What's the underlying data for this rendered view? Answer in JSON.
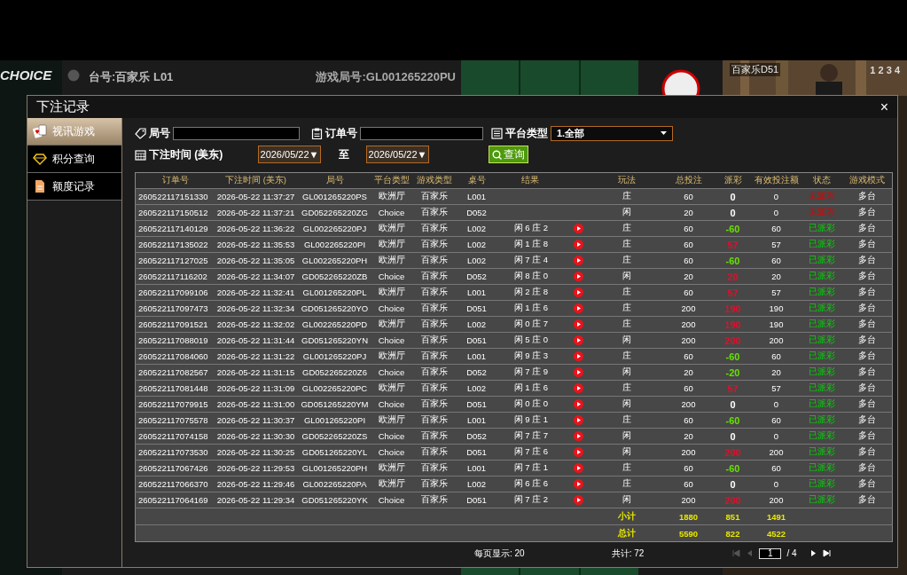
{
  "background": {
    "logo": "CHOICE",
    "table_label": "台号:百家乐 L01",
    "round_label": "游戏局号:GL001265220PU",
    "video_label": "百家乐D51",
    "seats": "1 2 3 4"
  },
  "window": {
    "title": "下注记录",
    "close": "×"
  },
  "sidebar": {
    "items": [
      {
        "label": "视讯游戏",
        "kind": "cards",
        "selected": true
      },
      {
        "label": "积分查询",
        "kind": "diamond",
        "selected": false
      },
      {
        "label": "额度记录",
        "kind": "document",
        "selected": false
      }
    ]
  },
  "filters": {
    "round": {
      "label": "局号"
    },
    "order": {
      "label": "订单号"
    },
    "platform": {
      "label": "平台类型",
      "value": "1.全部"
    },
    "time": {
      "label": "下注时间 (美东)",
      "from": "2026/05/22▼",
      "to_label": "至",
      "to": "2026/05/22▼"
    },
    "search_button": "查询"
  },
  "table": {
    "columns": [
      "订单号",
      "下注时间 (美东)",
      "局号",
      "平台类型",
      "游戏类型",
      "桌号",
      "结果",
      "",
      "玩法",
      "总投注",
      "派彩",
      "有效投注额",
      "状态",
      "游戏模式"
    ],
    "rows": [
      {
        "order": "260522117151330",
        "time": "2026-05-22 11:37:27",
        "round": "GL001265220PS",
        "platform": "欧洲厅",
        "game": "百家乐",
        "table": "L001",
        "result": "",
        "replay": false,
        "bet_type": "庄",
        "total": "60",
        "payout": {
          "text": "0",
          "color": "#ffffff"
        },
        "valid": "0",
        "status": {
          "text": "未派彩",
          "settled": false
        },
        "mode": "多台"
      },
      {
        "order": "260522117150512",
        "time": "2026-05-22 11:37:21",
        "round": "GD052265220ZG",
        "platform": "Choice",
        "game": "百家乐",
        "table": "D052",
        "result": "",
        "replay": false,
        "bet_type": "闲",
        "total": "20",
        "payout": {
          "text": "0",
          "color": "#ffffff"
        },
        "valid": "0",
        "status": {
          "text": "未派彩",
          "settled": false
        },
        "mode": "多台"
      },
      {
        "order": "260522117140129",
        "time": "2026-05-22 11:36:22",
        "round": "GL002265220PJ",
        "platform": "欧洲厅",
        "game": "百家乐",
        "table": "L002",
        "result": "闲 6 庄 2",
        "replay": true,
        "bet_type": "庄",
        "total": "60",
        "payout": {
          "text": "-60",
          "color": "#66e000"
        },
        "valid": "60",
        "status": {
          "text": "已派彩",
          "settled": true
        },
        "mode": "多台"
      },
      {
        "order": "260522117135022",
        "time": "2026-05-22 11:35:53",
        "round": "GL002265220PI",
        "platform": "欧洲厅",
        "game": "百家乐",
        "table": "L002",
        "result": "闲 1 庄 8",
        "replay": true,
        "bet_type": "庄",
        "total": "60",
        "payout": {
          "text": "57",
          "color": "#e0102a"
        },
        "valid": "57",
        "status": {
          "text": "已派彩",
          "settled": true
        },
        "mode": "多台"
      },
      {
        "order": "260522117127025",
        "time": "2026-05-22 11:35:05",
        "round": "GL002265220PH",
        "platform": "欧洲厅",
        "game": "百家乐",
        "table": "L002",
        "result": "闲 7 庄 4",
        "replay": true,
        "bet_type": "庄",
        "total": "60",
        "payout": {
          "text": "-60",
          "color": "#66e000"
        },
        "valid": "60",
        "status": {
          "text": "已派彩",
          "settled": true
        },
        "mode": "多台"
      },
      {
        "order": "260522117116202",
        "time": "2026-05-22 11:34:07",
        "round": "GD052265220ZB",
        "platform": "Choice",
        "game": "百家乐",
        "table": "D052",
        "result": "闲 8 庄 0",
        "replay": true,
        "bet_type": "闲",
        "total": "20",
        "payout": {
          "text": "20",
          "color": "#e0102a"
        },
        "valid": "20",
        "status": {
          "text": "已派彩",
          "settled": true
        },
        "mode": "多台"
      },
      {
        "order": "260522117099106",
        "time": "2026-05-22 11:32:41",
        "round": "GL001265220PL",
        "platform": "欧洲厅",
        "game": "百家乐",
        "table": "L001",
        "result": "闲 2 庄 8",
        "replay": true,
        "bet_type": "庄",
        "total": "60",
        "payout": {
          "text": "57",
          "color": "#e0102a"
        },
        "valid": "57",
        "status": {
          "text": "已派彩",
          "settled": true
        },
        "mode": "多台"
      },
      {
        "order": "260522117097473",
        "time": "2026-05-22 11:32:34",
        "round": "GD051265220YO",
        "platform": "Choice",
        "game": "百家乐",
        "table": "D051",
        "result": "闲 1 庄 6",
        "replay": true,
        "bet_type": "庄",
        "total": "200",
        "payout": {
          "text": "190",
          "color": "#e0102a"
        },
        "valid": "190",
        "status": {
          "text": "已派彩",
          "settled": true
        },
        "mode": "多台"
      },
      {
        "order": "260522117091521",
        "time": "2026-05-22 11:32:02",
        "round": "GL002265220PD",
        "platform": "欧洲厅",
        "game": "百家乐",
        "table": "L002",
        "result": "闲 0 庄 7",
        "replay": true,
        "bet_type": "庄",
        "total": "200",
        "payout": {
          "text": "190",
          "color": "#e0102a"
        },
        "valid": "190",
        "status": {
          "text": "已派彩",
          "settled": true
        },
        "mode": "多台"
      },
      {
        "order": "260522117088019",
        "time": "2026-05-22 11:31:44",
        "round": "GD051265220YN",
        "platform": "Choice",
        "game": "百家乐",
        "table": "D051",
        "result": "闲 5 庄 0",
        "replay": true,
        "bet_type": "闲",
        "total": "200",
        "payout": {
          "text": "200",
          "color": "#e0102a"
        },
        "valid": "200",
        "status": {
          "text": "已派彩",
          "settled": true
        },
        "mode": "多台"
      },
      {
        "order": "260522117084060",
        "time": "2026-05-22 11:31:22",
        "round": "GL001265220PJ",
        "platform": "欧洲厅",
        "game": "百家乐",
        "table": "L001",
        "result": "闲 9 庄 3",
        "replay": true,
        "bet_type": "庄",
        "total": "60",
        "payout": {
          "text": "-60",
          "color": "#66e000"
        },
        "valid": "60",
        "status": {
          "text": "已派彩",
          "settled": true
        },
        "mode": "多台"
      },
      {
        "order": "260522117082567",
        "time": "2026-05-22 11:31:15",
        "round": "GD052265220Z6",
        "platform": "Choice",
        "game": "百家乐",
        "table": "D052",
        "result": "闲 7 庄 9",
        "replay": true,
        "bet_type": "闲",
        "total": "20",
        "payout": {
          "text": "-20",
          "color": "#66e000"
        },
        "valid": "20",
        "status": {
          "text": "已派彩",
          "settled": true
        },
        "mode": "多台"
      },
      {
        "order": "260522117081448",
        "time": "2026-05-22 11:31:09",
        "round": "GL002265220PC",
        "platform": "欧洲厅",
        "game": "百家乐",
        "table": "L002",
        "result": "闲 1 庄 6",
        "replay": true,
        "bet_type": "庄",
        "total": "60",
        "payout": {
          "text": "57",
          "color": "#e0102a"
        },
        "valid": "57",
        "status": {
          "text": "已派彩",
          "settled": true
        },
        "mode": "多台"
      },
      {
        "order": "260522117079915",
        "time": "2026-05-22 11:31:00",
        "round": "GD051265220YM",
        "platform": "Choice",
        "game": "百家乐",
        "table": "D051",
        "result": "闲 0 庄 0",
        "replay": true,
        "bet_type": "闲",
        "total": "200",
        "payout": {
          "text": "0",
          "color": "#ffffff"
        },
        "valid": "0",
        "status": {
          "text": "已派彩",
          "settled": true
        },
        "mode": "多台"
      },
      {
        "order": "260522117075578",
        "time": "2026-05-22 11:30:37",
        "round": "GL001265220PI",
        "platform": "欧洲厅",
        "game": "百家乐",
        "table": "L001",
        "result": "闲 9 庄 1",
        "replay": true,
        "bet_type": "庄",
        "total": "60",
        "payout": {
          "text": "-60",
          "color": "#66e000"
        },
        "valid": "60",
        "status": {
          "text": "已派彩",
          "settled": true
        },
        "mode": "多台"
      },
      {
        "order": "260522117074158",
        "time": "2026-05-22 11:30:30",
        "round": "GD052265220ZS",
        "platform": "Choice",
        "game": "百家乐",
        "table": "D052",
        "result": "闲 7 庄 7",
        "replay": true,
        "bet_type": "闲",
        "total": "20",
        "payout": {
          "text": "0",
          "color": "#ffffff"
        },
        "valid": "0",
        "status": {
          "text": "已派彩",
          "settled": true
        },
        "mode": "多台"
      },
      {
        "order": "260522117073530",
        "time": "2026-05-22 11:30:25",
        "round": "GD051265220YL",
        "platform": "Choice",
        "game": "百家乐",
        "table": "D051",
        "result": "闲 7 庄 6",
        "replay": true,
        "bet_type": "闲",
        "total": "200",
        "payout": {
          "text": "200",
          "color": "#e0102a"
        },
        "valid": "200",
        "status": {
          "text": "已派彩",
          "settled": true
        },
        "mode": "多台"
      },
      {
        "order": "260522117067426",
        "time": "2026-05-22 11:29:53",
        "round": "GL001265220PH",
        "platform": "欧洲厅",
        "game": "百家乐",
        "table": "L001",
        "result": "闲 7 庄 1",
        "replay": true,
        "bet_type": "庄",
        "total": "60",
        "payout": {
          "text": "-60",
          "color": "#66e000"
        },
        "valid": "60",
        "status": {
          "text": "已派彩",
          "settled": true
        },
        "mode": "多台"
      },
      {
        "order": "260522117066370",
        "time": "2026-05-22 11:29:46",
        "round": "GL002265220PA",
        "platform": "欧洲厅",
        "game": "百家乐",
        "table": "L002",
        "result": "闲 6 庄 6",
        "replay": true,
        "bet_type": "庄",
        "total": "60",
        "payout": {
          "text": "0",
          "color": "#ffffff"
        },
        "valid": "0",
        "status": {
          "text": "已派彩",
          "settled": true
        },
        "mode": "多台"
      },
      {
        "order": "260522117064169",
        "time": "2026-05-22 11:29:34",
        "round": "GD051265220YK",
        "platform": "Choice",
        "game": "百家乐",
        "table": "D051",
        "result": "闲 7 庄 2",
        "replay": true,
        "bet_type": "闲",
        "total": "200",
        "payout": {
          "text": "200",
          "color": "#e0102a"
        },
        "valid": "200",
        "status": {
          "text": "已派彩",
          "settled": true
        },
        "mode": "多台"
      }
    ],
    "summary": [
      {
        "label": "小计",
        "total": "1880",
        "payout": "851",
        "valid": "1491"
      },
      {
        "label": "总计",
        "total": "5590",
        "payout": "822",
        "valid": "4522"
      }
    ]
  },
  "pagination": {
    "per_page": "每页显示: 20",
    "count": "共计: 72",
    "page": "1",
    "pages": "/ 4",
    "buttons": [
      {
        "kind": "first",
        "disabled": true
      },
      {
        "kind": "prev",
        "disabled": true
      },
      {
        "kind": "next",
        "disabled": false
      },
      {
        "kind": "last",
        "disabled": false
      }
    ]
  }
}
